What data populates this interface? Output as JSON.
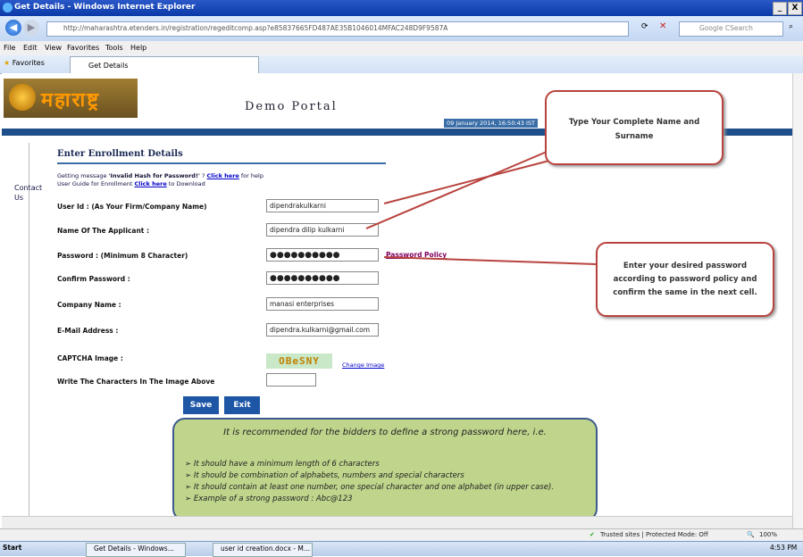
{
  "window": {
    "title": "Get Details - Windows Internet Explorer",
    "min": "_",
    "close": "X"
  },
  "address": {
    "url": "http://maharashtra.etenders.in/registration/regeditcomp.asp?e85837665FD487AE35B1046014MFAC248D9F9587A",
    "search_placeholder": "Google CSearch"
  },
  "menu": [
    "File",
    "Edit",
    "View",
    "Favorites",
    "Tools",
    "Help"
  ],
  "favorites": {
    "label": "Favorites",
    "tab": "Get Details"
  },
  "header": {
    "logo_text": "महाराष्ट्र",
    "portal": "Demo Portal",
    "date": "09 January 2014, 16:50:43 IST"
  },
  "sidebar": {
    "contact": "Contact",
    "us": "Us"
  },
  "form": {
    "title": "Enter Enrollment Details",
    "help1_pre": "Getting message ",
    "help1_bold": "'Invalid Hash for Password!'",
    "help1_mid": " ? ",
    "help1_link": "Click here",
    "help1_post": " for help",
    "help2_pre": "User Guide for Enrollment ",
    "help2_link": "Click here",
    "help2_post": " to Download",
    "fields": [
      {
        "label": "User Id : (As Your Firm/Company Name)",
        "value": "dipendrakulkarni"
      },
      {
        "label": "Name Of The Applicant :",
        "value": "dipendra dilip kulkarni"
      },
      {
        "label": "Password : (Minimum 8 Character)",
        "value": "●●●●●●●●●●"
      },
      {
        "label": "Confirm Password :",
        "value": "●●●●●●●●●●"
      },
      {
        "label": "Company Name :",
        "value": "manasi enterprises"
      },
      {
        "label": "E-Mail Address :",
        "value": "dipendra.kulkarni@gmail.com"
      }
    ],
    "password_policy": "Password Policy",
    "captcha_label": "CAPTCHA Image :",
    "captcha_text": "OBeSNY",
    "change_image": "Change Image",
    "captcha_input_label": "Write The Characters In The Image Above",
    "save": "Save",
    "exit": "Exit"
  },
  "callouts": {
    "name": "Type Your Complete Name and Surname",
    "password": "Enter your desired password according to password policy and confirm the same in the next cell."
  },
  "note": {
    "heading": "It is recommended for the bidders to define a strong password here, i.e.",
    "items": [
      "It should have a minimum length of 6 characters",
      "It should be combination of alphabets, numbers and special characters",
      "It should  contain at least one number, one special character and one alphabet  (in upper case).",
      "Example of a strong password : Abc@123"
    ]
  },
  "status": {
    "zone": "Trusted sites | Protected Mode: Off",
    "zoom": "100%"
  },
  "taskbar": {
    "start": "Start",
    "task1": "Get Details - Windows...",
    "task2": "user id creation.docx - M...",
    "clock": "4:53 PM"
  }
}
